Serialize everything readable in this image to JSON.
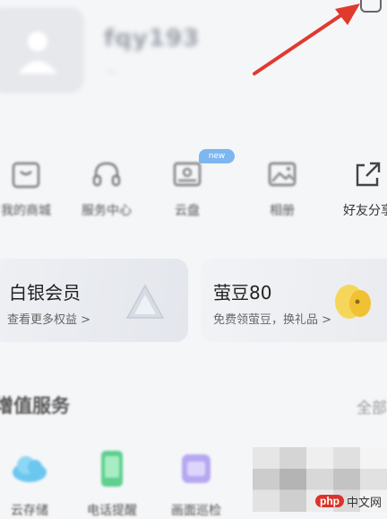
{
  "profile": {
    "username": "fqy193",
    "user_id": "...",
    "edit_icon": "edit-icon"
  },
  "quick_actions": [
    {
      "label": "我的商城",
      "icon": "store-icon"
    },
    {
      "label": "服务中心",
      "icon": "headset-icon"
    },
    {
      "label": "云盘",
      "icon": "cloud-drive-icon",
      "badge": "new"
    },
    {
      "label": "相册",
      "icon": "photo-icon"
    },
    {
      "label": "好友分享",
      "icon": "share-icon"
    }
  ],
  "cards": [
    {
      "title": "白银会员",
      "subtitle": "查看更多权益 >"
    },
    {
      "title": "萤豆80",
      "subtitle": "免费领萤豆，换礼品 >"
    }
  ],
  "value_services": {
    "title": "增值服务",
    "see_all": "全部",
    "items": [
      {
        "label": "云存储",
        "icon": "cloud-icon"
      },
      {
        "label": "电话提醒",
        "icon": "phone-icon"
      },
      {
        "label": "画面巡检",
        "icon": "folder-icon"
      }
    ]
  },
  "watermark": {
    "logo": "php",
    "text": "中文网"
  },
  "colors": {
    "accent_blue": "#7db7f0",
    "arrow_red": "#e03a2f"
  }
}
